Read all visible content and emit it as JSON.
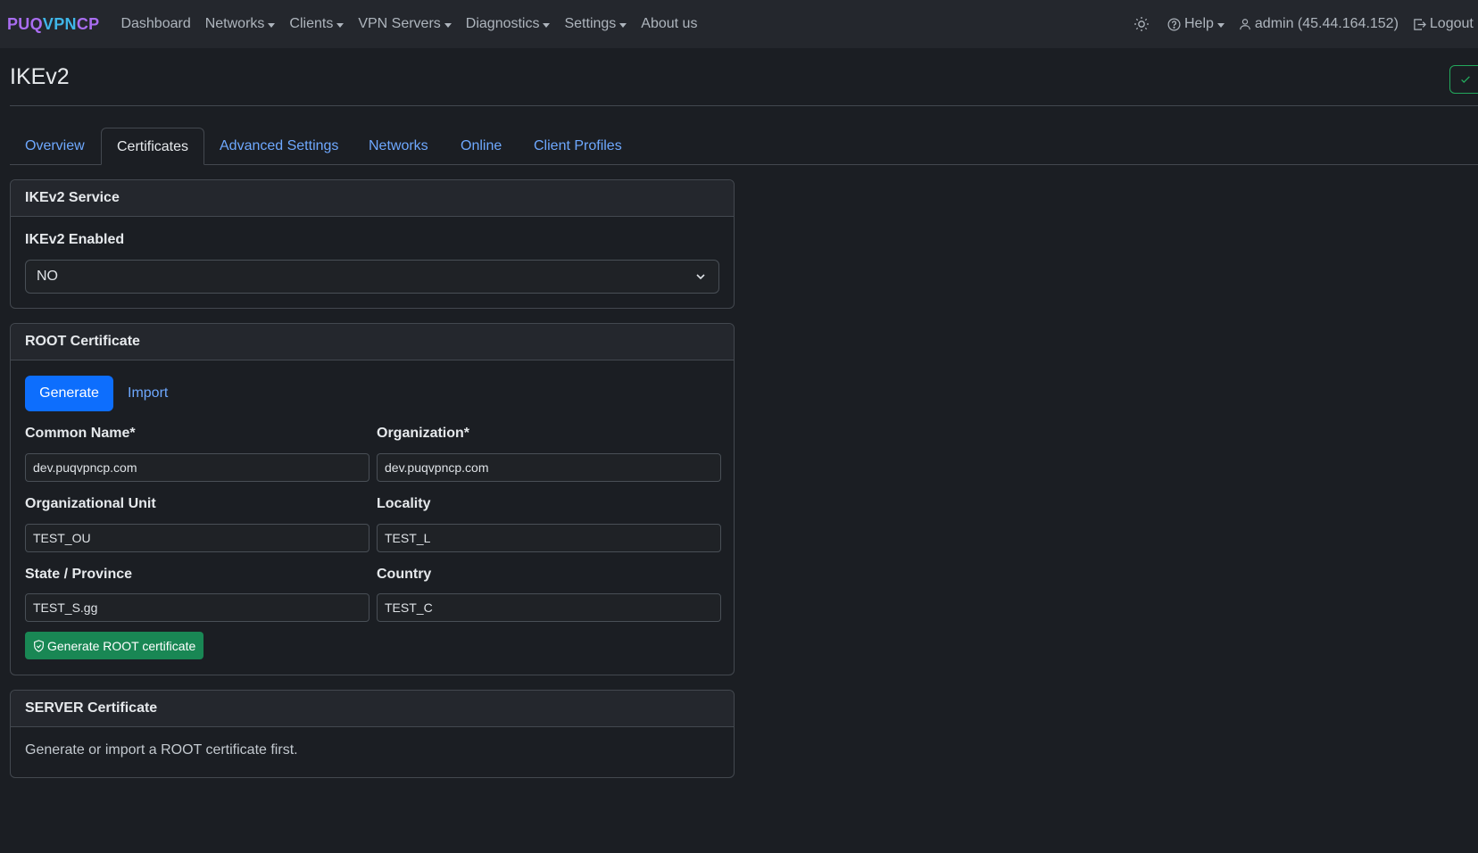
{
  "navbar": {
    "brand_p1": "PUQ",
    "brand_p2": "VPN",
    "brand_p3": "CP",
    "items": [
      {
        "label": "Dashboard",
        "dropdown": false
      },
      {
        "label": "Networks",
        "dropdown": true
      },
      {
        "label": "Clients",
        "dropdown": true
      },
      {
        "label": "VPN Servers",
        "dropdown": true
      },
      {
        "label": "Diagnostics",
        "dropdown": true
      },
      {
        "label": "Settings",
        "dropdown": true
      },
      {
        "label": "About us",
        "dropdown": false
      }
    ],
    "help_label": "Help",
    "user_label": "admin (45.44.164.152)",
    "logout_label": "Logout"
  },
  "page": {
    "title": "IKEv2"
  },
  "tabs": [
    {
      "label": "Overview",
      "active": false
    },
    {
      "label": "Certificates",
      "active": true
    },
    {
      "label": "Advanced Settings",
      "active": false
    },
    {
      "label": "Networks",
      "active": false
    },
    {
      "label": "Online",
      "active": false
    },
    {
      "label": "Client Profiles",
      "active": false
    }
  ],
  "service_card": {
    "header": "IKEv2 Service",
    "enabled_label": "IKEv2 Enabled",
    "enabled_value": "NO"
  },
  "root_card": {
    "header": "ROOT Certificate",
    "generate_label": "Generate",
    "import_label": "Import",
    "fields": {
      "common_name": {
        "label": "Common Name*",
        "value": "dev.puqvpncp.com"
      },
      "organization": {
        "label": "Organization*",
        "value": "dev.puqvpncp.com"
      },
      "org_unit": {
        "label": "Organizational Unit",
        "value": "TEST_OU"
      },
      "locality": {
        "label": "Locality",
        "value": "TEST_L"
      },
      "state": {
        "label": "State / Province",
        "value": "TEST_S.gg"
      },
      "country": {
        "label": "Country",
        "value": "TEST_C"
      }
    },
    "submit_label": "Generate ROOT certificate"
  },
  "server_card": {
    "header": "SERVER Certificate",
    "message": "Generate or import a ROOT certificate first."
  },
  "colors": {
    "background": "#1b1e23",
    "navbar": "#24272d",
    "link": "#6ea8fe",
    "primary": "#0d6efd",
    "success": "#198754",
    "brand_purple": "#a96df0",
    "brand_blue": "#3fb6e8"
  },
  "icons": [
    "sun-icon",
    "help-circle-icon",
    "user-icon",
    "logout-icon",
    "check-icon",
    "chevron-down-icon",
    "shield-icon"
  ]
}
